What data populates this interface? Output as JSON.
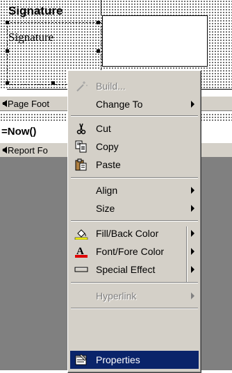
{
  "report": {
    "signature_label": "Signature",
    "signature_field": "Signature",
    "page_footer_label": "Page Foot",
    "now_expression": "=Now()",
    "report_footer_label": "Report Fo"
  },
  "context_menu": {
    "build": {
      "label": "Build...",
      "icon": "build-wand-icon",
      "enabled": false
    },
    "change_to": {
      "label": "Change To",
      "submenu": true
    },
    "cut": {
      "label": "Cut",
      "icon": "scissors-icon"
    },
    "copy": {
      "label": "Copy",
      "icon": "copy-icon"
    },
    "paste": {
      "label": "Paste",
      "icon": "paste-icon"
    },
    "align": {
      "label": "Align",
      "submenu": true
    },
    "size": {
      "label": "Size",
      "submenu": true
    },
    "fill_back_color": {
      "label": "Fill/Back Color",
      "icon": "paint-bucket-icon",
      "submenu": true
    },
    "font_fore_color": {
      "label": "Font/Fore Color",
      "icon": "font-color-icon",
      "submenu": true
    },
    "special_effect": {
      "label": "Special Effect",
      "icon": "special-effect-icon",
      "submenu": true
    },
    "hyperlink": {
      "label": "Hyperlink",
      "enabled": false,
      "submenu": true
    },
    "properties": {
      "label": "Properties",
      "icon": "properties-icon",
      "highlighted": true
    }
  },
  "colors": {
    "menu_background": "#d4d0c8",
    "highlight": "#0a246a",
    "design_gray": "#808080",
    "font_color_underline": "#e00000"
  }
}
